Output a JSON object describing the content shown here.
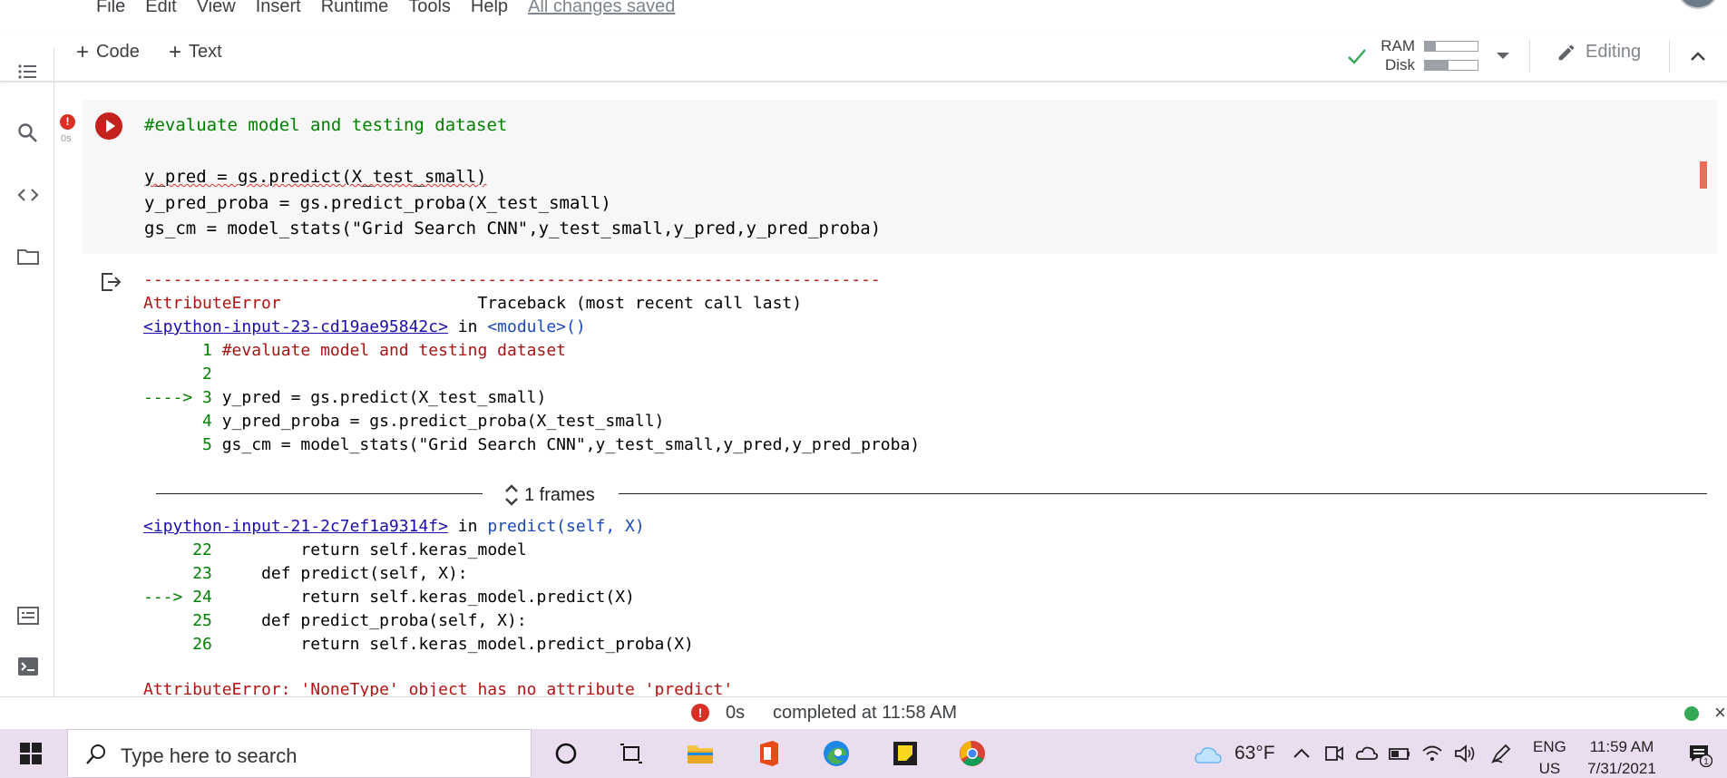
{
  "menu": {
    "items": [
      "File",
      "Edit",
      "View",
      "Insert",
      "Runtime",
      "Tools",
      "Help"
    ],
    "save_status": "All changes saved"
  },
  "toolbar": {
    "code_label": "Code",
    "text_label": "Text",
    "plus": "+",
    "ram_label": "RAM",
    "disk_label": "Disk",
    "ram_usage": 0.2,
    "disk_usage": 0.45,
    "editing_label": "Editing"
  },
  "cell": {
    "error_badge": "!",
    "exec_time": "0s",
    "code_lines": [
      {
        "type": "comment",
        "text": "#evaluate model and testing dataset"
      },
      {
        "type": "blank",
        "text": ""
      },
      {
        "type": "code",
        "text": "y_pred = gs.predict(X_test_small)"
      },
      {
        "type": "code",
        "text": "y_pred_proba = gs.predict_proba(X_test_small)"
      },
      {
        "type": "code",
        "text": "gs_cm = model_stats(\"Grid Search CNN\",y_test_small,y_pred,y_pred_proba)"
      }
    ]
  },
  "traceback": {
    "divider": "---------------------------------------------------------------------------",
    "error_name": "AttributeError",
    "header_right": "Traceback (most recent call last)",
    "frame1": {
      "link": "<ipython-input-23-cd19ae95842c>",
      "in": "in",
      "location": "<module>()",
      "lines": [
        {
          "prefix": "      ",
          "num": "1",
          "text": "#evaluate model and testing dataset"
        },
        {
          "prefix": "      ",
          "num": "2",
          "text": ""
        },
        {
          "prefix": "----> ",
          "num": "3",
          "text": "y_pred = gs.predict(X_test_small)"
        },
        {
          "prefix": "      ",
          "num": "4",
          "text": "y_pred_proba = gs.predict_proba(X_test_small)"
        },
        {
          "prefix": "      ",
          "num": "5",
          "text": "gs_cm = model_stats(\"Grid Search CNN\",y_test_small,y_pred,y_pred_proba)"
        }
      ]
    },
    "frames_label": "1 frames",
    "frame2": {
      "link": "<ipython-input-21-2c7ef1a9314f>",
      "in": "in",
      "location": "predict(self, X)",
      "lines": [
        {
          "prefix": "     ",
          "num": "22",
          "text": "        return self.keras_model"
        },
        {
          "prefix": "     ",
          "num": "23",
          "text": "    def predict(self, X):"
        },
        {
          "prefix": "---> ",
          "num": "24",
          "text": "        return self.keras_model.predict(X)"
        },
        {
          "prefix": "     ",
          "num": "25",
          "text": "    def predict_proba(self, X):"
        },
        {
          "prefix": "     ",
          "num": "26",
          "text": "        return self.keras_model.predict_proba(X)"
        }
      ]
    },
    "final_error": "AttributeError: 'NoneType' object has no attribute 'predict'"
  },
  "statusbar": {
    "error_badge": "!",
    "time": "0s",
    "message": "completed at 11:58 AM",
    "close": "×"
  },
  "taskbar": {
    "search_placeholder": "Type here to search",
    "temperature": "63°F",
    "lang_top": "ENG",
    "lang_bottom": "US",
    "time": "11:59 AM",
    "date": "7/31/2021",
    "notification_count": "1"
  },
  "colors": {
    "error_red": "#d93025",
    "comment_green": "#008000",
    "string_red": "#a31515",
    "link_blue": "#1a0dab",
    "taskbar_bg": "#eaddef"
  }
}
